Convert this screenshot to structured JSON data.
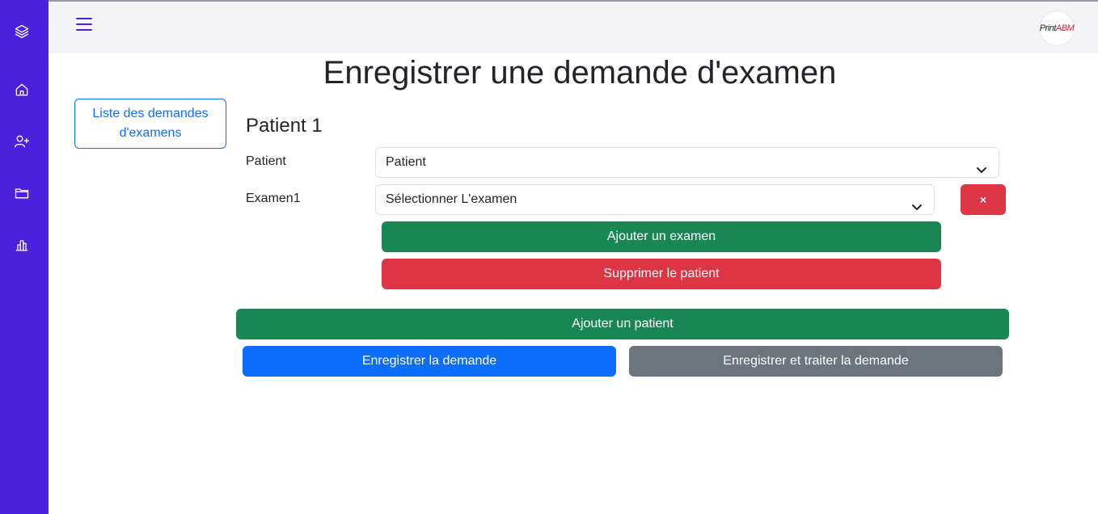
{
  "sidebar": {
    "icons": [
      "layers-icon",
      "home-icon",
      "user-plus-icon",
      "folder-icon",
      "bar-chart-icon"
    ]
  },
  "topbar": {
    "logo_text_a": "Print",
    "logo_text_b": "ABM"
  },
  "page": {
    "title": "Enregistrer une demande d'examen",
    "list_link": "Liste des demandes d'examens"
  },
  "form": {
    "patient_heading": "Patient 1",
    "patient_label": "Patient",
    "patient_value": "Patient",
    "exam_label": "Examen1",
    "exam_value": "Sélectionner L'examen",
    "remove_exam_label": "×",
    "add_exam_label": "Ajouter un examen",
    "delete_patient_label": "Supprimer le patient",
    "add_patient_label": "Ajouter un patient",
    "save_label": "Enregistrer la demande",
    "save_process_label": "Enregistrer et traiter la demande"
  },
  "colors": {
    "sidebar": "#4a22dd",
    "success": "#198754",
    "danger": "#dc3545",
    "primary": "#0d6efd",
    "secondary": "#6c757d"
  }
}
